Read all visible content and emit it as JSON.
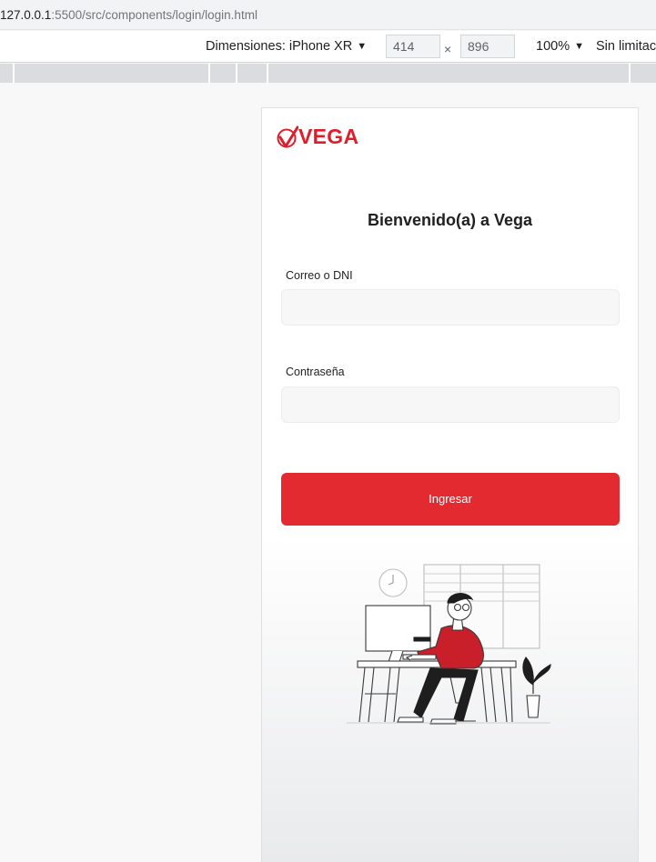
{
  "browser": {
    "url_host": "127.0.0.1",
    "url_rest": ":5500/src/components/login/login.html"
  },
  "devtools": {
    "device_label": "Dimensiones: iPhone XR",
    "width": "414",
    "height": "896",
    "times_symbol": "×",
    "zoom": "100%",
    "throttle": "Sin limitac",
    "caret": "▼"
  },
  "app": {
    "logo_text": "VEGA",
    "welcome": "Bienvenido(a) a Vega",
    "email_label": "Correo o DNI",
    "email_value": "",
    "password_label": "Contraseña",
    "password_value": "",
    "submit_label": "Ingresar",
    "brand_color": "#e42a31"
  }
}
